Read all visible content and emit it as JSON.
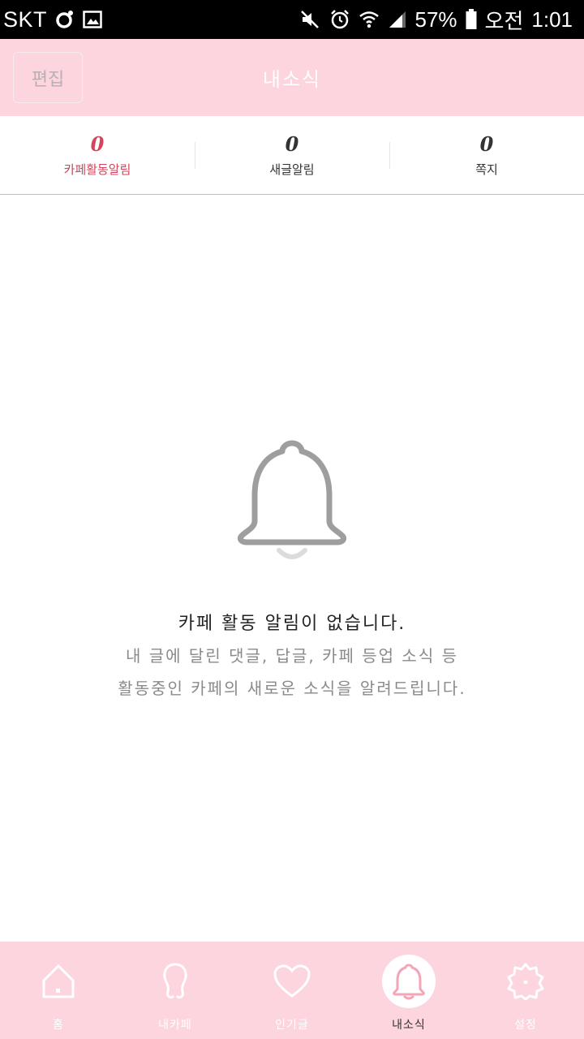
{
  "status_bar": {
    "carrier": "SKT",
    "battery": "57%",
    "ampm": "오전",
    "time": "1:01"
  },
  "header": {
    "edit_label": "편집",
    "title": "내소식"
  },
  "tabs": [
    {
      "count": "0",
      "label": "카페활동알림"
    },
    {
      "count": "0",
      "label": "새글알림"
    },
    {
      "count": "0",
      "label": "쪽지"
    }
  ],
  "empty_state": {
    "title": "카페 활동 알림이 없습니다.",
    "description_line1": "내 글에 달린 댓글, 답글, 카페 등업 소식 등",
    "description_line2": "활동중인 카페의 새로운 소식을 알려드립니다."
  },
  "bottom_nav": [
    {
      "label": "홈",
      "icon": "home-icon"
    },
    {
      "label": "내카페",
      "icon": "person-icon"
    },
    {
      "label": "인기글",
      "icon": "heart-icon"
    },
    {
      "label": "내소식",
      "icon": "bell-icon"
    },
    {
      "label": "설정",
      "icon": "gear-icon"
    }
  ],
  "colors": {
    "accent_pink": "#fcd5de",
    "active_red": "#d2455a"
  }
}
